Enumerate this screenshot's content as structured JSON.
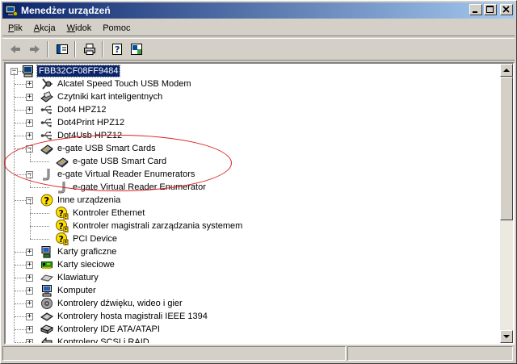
{
  "window": {
    "title": "Menedżer urządzeń"
  },
  "menu": [
    {
      "label": "Plik",
      "accel": "P",
      "rest": "lik"
    },
    {
      "label": "Akcja",
      "accel": "A",
      "rest": "kcja"
    },
    {
      "label": "Widok",
      "accel": "W",
      "rest": "idok"
    },
    {
      "label": "Pomoc",
      "accel": "",
      "rest": "Pomoc"
    }
  ],
  "toolbar": [
    "back-icon",
    "forward-icon",
    "console-tree-icon",
    "print-icon",
    "help-icon",
    "properties-icon"
  ],
  "tree": {
    "root": "FBB32CF08FF9484",
    "items": [
      {
        "label": "Alcatel Speed Touch USB Modem",
        "level": 1,
        "expander": "+",
        "icon": "modem-icon"
      },
      {
        "label": "Czytniki kart inteligentnych",
        "level": 1,
        "expander": "+",
        "icon": "smartcard-reader-icon"
      },
      {
        "label": "Dot4 HPZ12",
        "level": 1,
        "expander": "+",
        "icon": "usb-icon"
      },
      {
        "label": "Dot4Print HPZ12",
        "level": 1,
        "expander": "+",
        "icon": "usb-icon"
      },
      {
        "label": "Dot4Usb HPZ12",
        "level": 1,
        "expander": "+",
        "icon": "usb-icon"
      },
      {
        "label": "e-gate USB Smart Cards",
        "level": 1,
        "expander": "−",
        "icon": "smartcard-icon"
      },
      {
        "label": "e-gate USB Smart Card",
        "level": 2,
        "expander": "",
        "icon": "smartcard-icon"
      },
      {
        "label": "e-gate Virtual Reader Enumerators",
        "level": 1,
        "expander": "−",
        "icon": "reader-enum-icon"
      },
      {
        "label": "e-gate Virtual Reader Enumerator",
        "level": 2,
        "expander": "",
        "icon": "reader-enum-icon"
      },
      {
        "label": "Inne urządzenia",
        "level": 1,
        "expander": "−",
        "icon": "unknown-device-icon"
      },
      {
        "label": "Kontroler Ethernet",
        "level": 2,
        "expander": "",
        "icon": "warning-device-icon"
      },
      {
        "label": "Kontroler magistrali zarządzania systemem",
        "level": 2,
        "expander": "",
        "icon": "warning-device-icon"
      },
      {
        "label": "PCI Device",
        "level": 2,
        "expander": "",
        "icon": "warning-device-icon"
      },
      {
        "label": "Karty graficzne",
        "level": 1,
        "expander": "+",
        "icon": "display-adapter-icon"
      },
      {
        "label": "Karty sieciowe",
        "level": 1,
        "expander": "+",
        "icon": "network-card-icon"
      },
      {
        "label": "Klawiatury",
        "level": 1,
        "expander": "+",
        "icon": "keyboard-icon"
      },
      {
        "label": "Komputer",
        "level": 1,
        "expander": "+",
        "icon": "computer-icon"
      },
      {
        "label": "Kontrolery dźwięku, wideo i gier",
        "level": 1,
        "expander": "+",
        "icon": "sound-icon"
      },
      {
        "label": "Kontrolery hosta magistrali IEEE 1394",
        "level": 1,
        "expander": "+",
        "icon": "ieee1394-icon"
      },
      {
        "label": "Kontrolery IDE ATA/ATAPI",
        "level": 1,
        "expander": "+",
        "icon": "ide-icon"
      },
      {
        "label": "Kontrolery SCSI i RAID",
        "level": 1,
        "expander": "+",
        "icon": "scsi-icon"
      }
    ]
  },
  "colors": {
    "title_start": "#0a246a",
    "title_end": "#a6caf0",
    "selection": "#0a246a",
    "annotation": "#e02020"
  }
}
